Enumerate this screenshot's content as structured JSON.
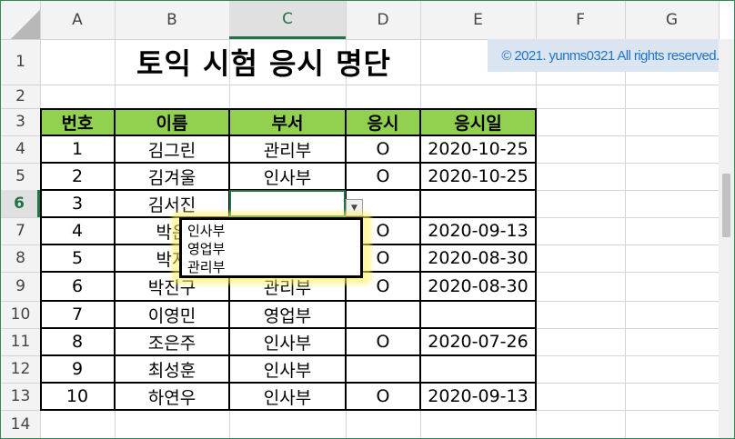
{
  "columns": [
    "A",
    "B",
    "C",
    "D",
    "E",
    "F",
    "G"
  ],
  "rows": [
    "1",
    "2",
    "3",
    "4",
    "5",
    "6",
    "7",
    "8",
    "9",
    "10",
    "11",
    "12",
    "13",
    "14"
  ],
  "selected_column": "C",
  "selected_row": "6",
  "title": "토익 시험 응시 명단",
  "copyright": "© 2021. yunms0321 All rights reserved.",
  "table": {
    "headers": [
      "번호",
      "이름",
      "부서",
      "응시",
      "응시일"
    ],
    "rows": [
      [
        "1",
        "김그린",
        "관리부",
        "O",
        "2020-10-25"
      ],
      [
        "2",
        "김겨울",
        "인사부",
        "O",
        "2020-10-25"
      ],
      [
        "3",
        "김서진",
        "",
        "",
        ""
      ],
      [
        "4",
        "박은",
        "",
        "O",
        "2020-09-13"
      ],
      [
        "5",
        "박지",
        "",
        "O",
        "2020-08-30"
      ],
      [
        "6",
        "박진구",
        "관리부",
        "O",
        "2020-08-30"
      ],
      [
        "7",
        "이영민",
        "영업부",
        "",
        ""
      ],
      [
        "8",
        "조은주",
        "인사부",
        "O",
        "2020-07-26"
      ],
      [
        "9",
        "최성훈",
        "인사부",
        "",
        ""
      ],
      [
        "10",
        "하연우",
        "인사부",
        "O",
        "2020-09-13"
      ]
    ]
  },
  "dropdown": {
    "arrow_icon": "chevron-down-icon",
    "options": [
      "인사부",
      "영업부",
      "관리부"
    ]
  },
  "colors": {
    "header_fill": "#92d050",
    "selection_accent": "#217346",
    "copyright_fill": "#dbe5f1",
    "copyright_text": "#1f74c8",
    "highlight": "#fff05a"
  }
}
